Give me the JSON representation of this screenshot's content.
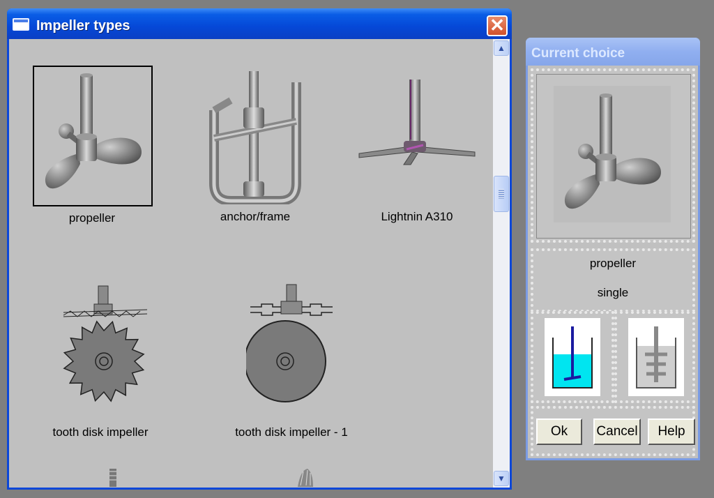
{
  "impeller_window": {
    "title": "Impeller types",
    "close_glyph": "✕",
    "scroll_up_glyph": "▲",
    "scroll_down_glyph": "▼",
    "items": [
      {
        "label": "propeller",
        "icon": "propeller-icon",
        "selected": true
      },
      {
        "label": "anchor/frame",
        "icon": "anchor-frame-icon"
      },
      {
        "label": "Lightnin A310",
        "icon": "lightnin-a310-icon"
      },
      {
        "label": "tooth disk impeller",
        "icon": "tooth-disk-impeller-icon"
      },
      {
        "label": "tooth disk impeller - 1",
        "icon": "tooth-disk-impeller-1-icon"
      }
    ]
  },
  "choice_window": {
    "title": "Current choice",
    "impeller_name": "propeller",
    "impeller_mode": "single",
    "buttons": {
      "ok": "Ok",
      "cancel": "Cancel",
      "help": "Help"
    }
  },
  "colors": {
    "xp_blue": "#0548d7",
    "liquid_cyan": "#00e5f0",
    "window_gray": "#c0c0c0"
  }
}
